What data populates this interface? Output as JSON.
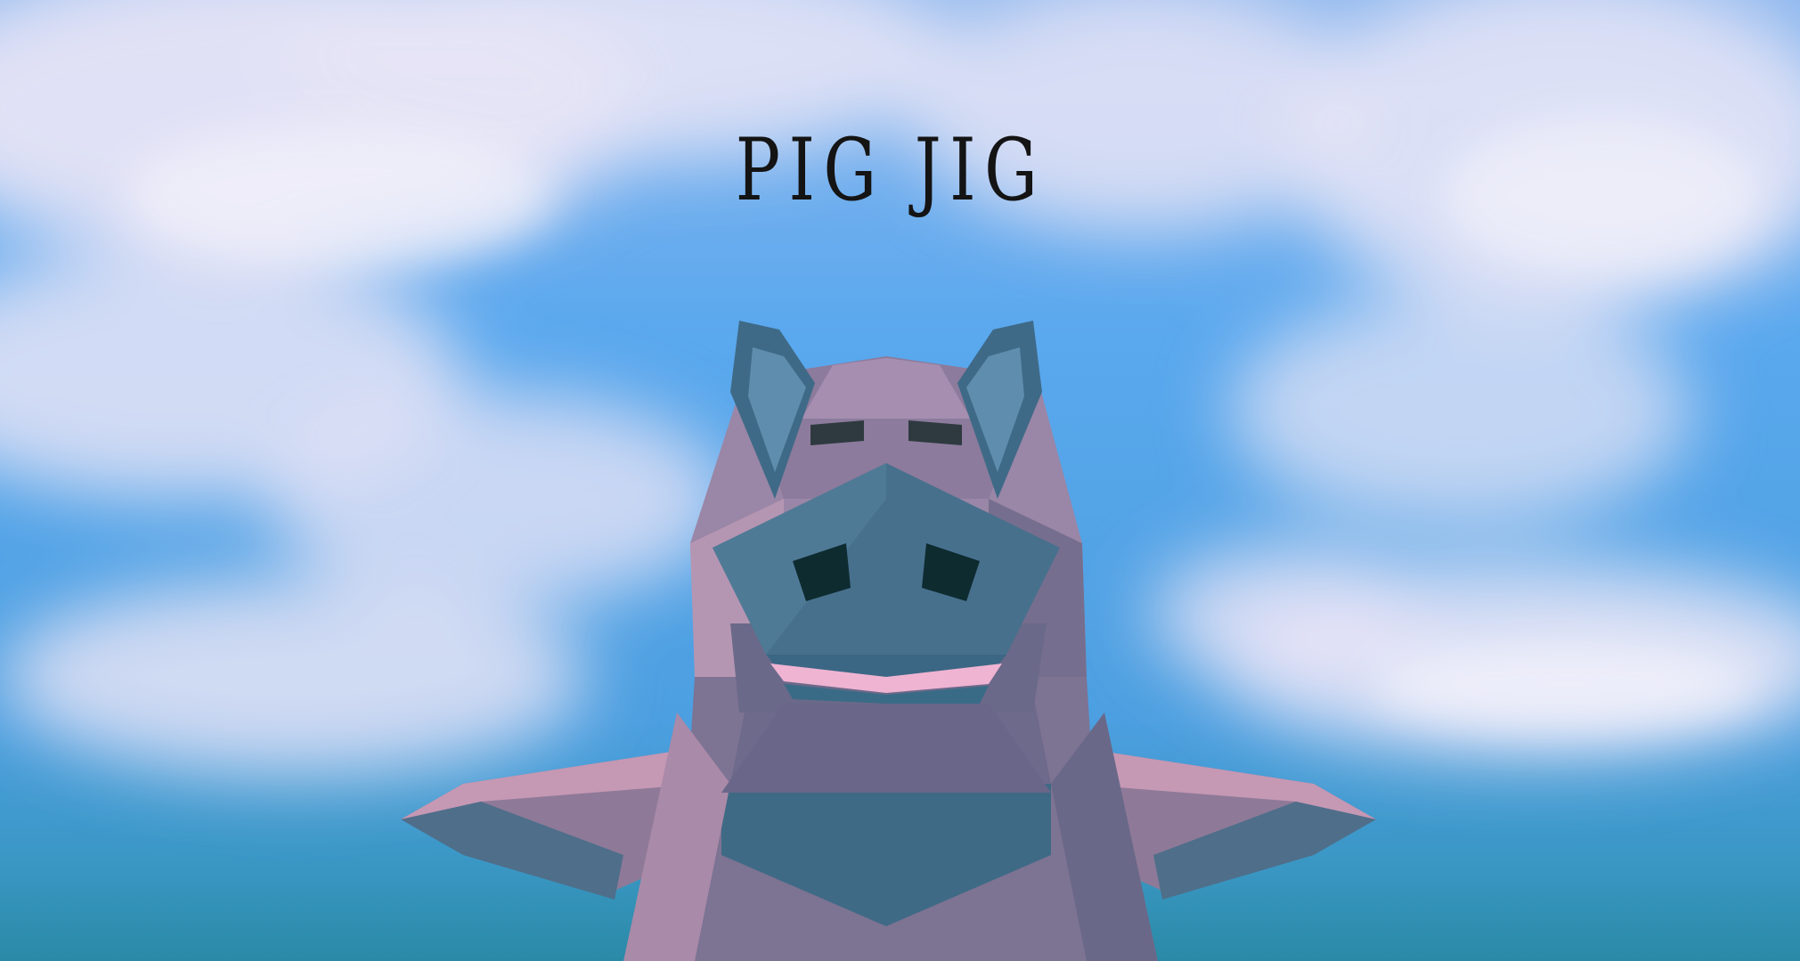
{
  "game": {
    "title": "PIG JIG"
  },
  "colors": {
    "sky_top": "#7fb4f0",
    "sky_mid": "#4aa3ee",
    "horizon": "#2f8fb0",
    "cloud": "#eae8f8",
    "pig_pink": "#c99ab6",
    "pig_shadow": "#4a6e8c",
    "pig_dark": "#0f2d32"
  },
  "icons": {
    "character": "pig-character"
  }
}
